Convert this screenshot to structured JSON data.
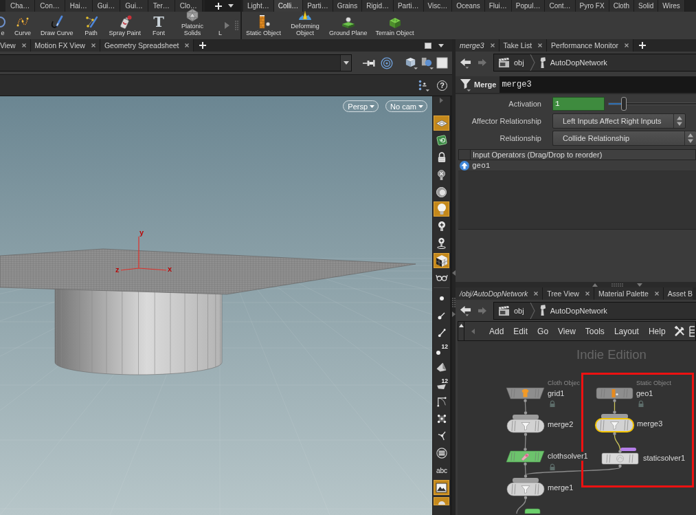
{
  "shelf_sets": [
    {
      "tabs": [
        {
          "label": "Cha…",
          "selected": false
        },
        {
          "label": "Con…",
          "selected": false
        },
        {
          "label": "Hai…",
          "selected": false
        },
        {
          "label": "Gui…",
          "selected": false
        },
        {
          "label": "Gui…",
          "selected": false
        },
        {
          "label": "Ter…",
          "selected": false
        },
        {
          "label": "Clo…",
          "selected": false
        }
      ],
      "add_tab_button": true,
      "tools": [
        {
          "kind": "circle",
          "label": "e"
        },
        {
          "kind": "curve",
          "label": "Curve"
        },
        {
          "kind": "drawcurve",
          "label": "Draw Curve"
        },
        {
          "kind": "path",
          "label": "Path"
        },
        {
          "kind": "spray",
          "label": "Spray Paint"
        },
        {
          "kind": "font",
          "label": "Font",
          "glyph": "T"
        },
        {
          "kind": "platonic",
          "label": "Platonic Solids"
        },
        {
          "kind": "blank",
          "label": "L"
        }
      ],
      "scroll_arrow": true
    },
    {
      "tabs": [
        {
          "label": "Light…",
          "selected": false
        },
        {
          "label": "Colli…",
          "selected": true
        },
        {
          "label": "Parti…",
          "selected": false
        },
        {
          "label": "Grains",
          "selected": false
        },
        {
          "label": "Rigid…",
          "selected": false
        },
        {
          "label": "Parti…",
          "selected": false
        },
        {
          "label": "Visc…",
          "selected": false
        },
        {
          "label": "Oceans",
          "selected": false
        },
        {
          "label": "Flui…",
          "selected": false
        },
        {
          "label": "Popul…",
          "selected": false
        },
        {
          "label": "Cont…",
          "selected": false
        },
        {
          "label": "Pyro FX",
          "selected": false
        },
        {
          "label": "Cloth",
          "selected": false
        },
        {
          "label": "Solid",
          "selected": false
        },
        {
          "label": "Wires",
          "selected": false
        }
      ],
      "tools": [
        {
          "kind": "static",
          "label": "Static Object"
        },
        {
          "kind": "deforming",
          "label": "Deforming Object"
        },
        {
          "kind": "ground",
          "label": "Ground Plane"
        },
        {
          "kind": "terrain",
          "label": "Terrain Object"
        }
      ]
    }
  ],
  "viewport_pane": {
    "tabs": [
      {
        "label": "View",
        "selected": false
      },
      {
        "label": "Motion FX View",
        "selected": false
      },
      {
        "label": "Geometry Spreadsheet",
        "selected": false
      }
    ],
    "help_glyph": "?",
    "camera_menus": [
      "Persp",
      "No cam"
    ],
    "axis_labels": [
      "y",
      "z",
      "x"
    ],
    "tool_groups": [
      [
        {
          "kind": "plane",
          "on": true
        },
        {
          "kind": "spiral",
          "on": false
        },
        {
          "kind": "lock",
          "on": false
        },
        {
          "kind": "nolight",
          "on": false
        },
        {
          "kind": "sphere",
          "on": false
        },
        {
          "kind": "bulb",
          "on": true
        },
        {
          "kind": "addlight",
          "on": false
        },
        {
          "kind": "spotlight",
          "on": false
        },
        {
          "kind": "checker",
          "on": true
        },
        {
          "kind": "glasses",
          "on": false
        }
      ],
      [
        {
          "kind": "dot",
          "on": false
        },
        {
          "kind": "hook",
          "on": false
        },
        {
          "kind": "pin",
          "on": false
        },
        {
          "kind": "pointnum",
          "on": false,
          "label": "12"
        },
        {
          "kind": "face",
          "on": false
        },
        {
          "kind": "facenum",
          "on": false,
          "label": "12"
        },
        {
          "kind": "corner",
          "on": false
        },
        {
          "kind": "points",
          "on": false
        },
        {
          "kind": "normals",
          "on": false
        },
        {
          "kind": "disc",
          "on": false
        },
        {
          "kind": "text",
          "on": false,
          "label": "abc"
        },
        {
          "kind": "picture",
          "on": true
        },
        {
          "kind": "partial",
          "on": true
        }
      ]
    ]
  },
  "parameter_pane": {
    "tabs": [
      {
        "label": "merge3",
        "selected": true
      },
      {
        "label": "Take List",
        "selected": false
      },
      {
        "label": "Performance Monitor",
        "selected": false
      }
    ],
    "path": [
      "obj",
      "AutoDopNetwork"
    ],
    "node_type": "Merge",
    "node_name": "merge3",
    "parameters": [
      {
        "kind": "slider",
        "label": "Activation",
        "value": "1",
        "level": 0.17
      },
      {
        "kind": "menu",
        "label": "Affector Relationship",
        "value": "Left Inputs Affect Right Inputs"
      },
      {
        "kind": "menu",
        "label": "Relationship",
        "value": "Collide Relationship"
      }
    ],
    "input_operators": {
      "header": "Input Operators (Drag/Drop to reorder)",
      "rows": [
        "geo1"
      ]
    }
  },
  "network_pane": {
    "tabs": [
      {
        "label": "/obj/AutoDopNetwork",
        "selected": true
      },
      {
        "label": "Tree View",
        "selected": false
      },
      {
        "label": "Material Palette",
        "selected": false
      },
      {
        "label": "Asset B",
        "selected": false,
        "cut": true
      }
    ],
    "path": [
      "obj",
      "AutoDopNetwork"
    ],
    "menu": [
      "Add",
      "Edit",
      "Go",
      "View",
      "Tools",
      "Layout",
      "Help"
    ],
    "edition": "Indie Edition",
    "nodes": [
      {
        "kind": "clothobject",
        "name": "grid1",
        "type_label": "Cloth Objec",
        "color": "#8e8e8e",
        "locked": true,
        "selected": false,
        "flag": false
      },
      {
        "kind": "staticobject",
        "name": "geo1",
        "type_label": "Static Object",
        "color": "#8e8e8e",
        "locked": true,
        "selected": false,
        "flag": false
      },
      {
        "kind": "merge",
        "name": "merge2",
        "color": "#d2d2d2",
        "locked": false,
        "selected": false,
        "flag": false
      },
      {
        "kind": "merge",
        "name": "merge3",
        "color": "#d2d2d2",
        "locked": false,
        "selected": true,
        "flag": false
      },
      {
        "kind": "clothsolver",
        "name": "clothsolver1",
        "color": "#6cc46c",
        "locked": true,
        "selected": false,
        "flag": false
      },
      {
        "kind": "staticsolver",
        "name": "staticsolver1",
        "color": "#d9d9d9",
        "locked": false,
        "selected": false,
        "flag": true
      },
      {
        "kind": "merge",
        "name": "merge1",
        "color": "#d2d2d2",
        "locked": false,
        "selected": false,
        "flag": false
      },
      {
        "kind": "partial",
        "color": "#6ccf6c",
        "locked": false,
        "selected": false,
        "flag": false
      }
    ],
    "highlight_frame": true
  }
}
